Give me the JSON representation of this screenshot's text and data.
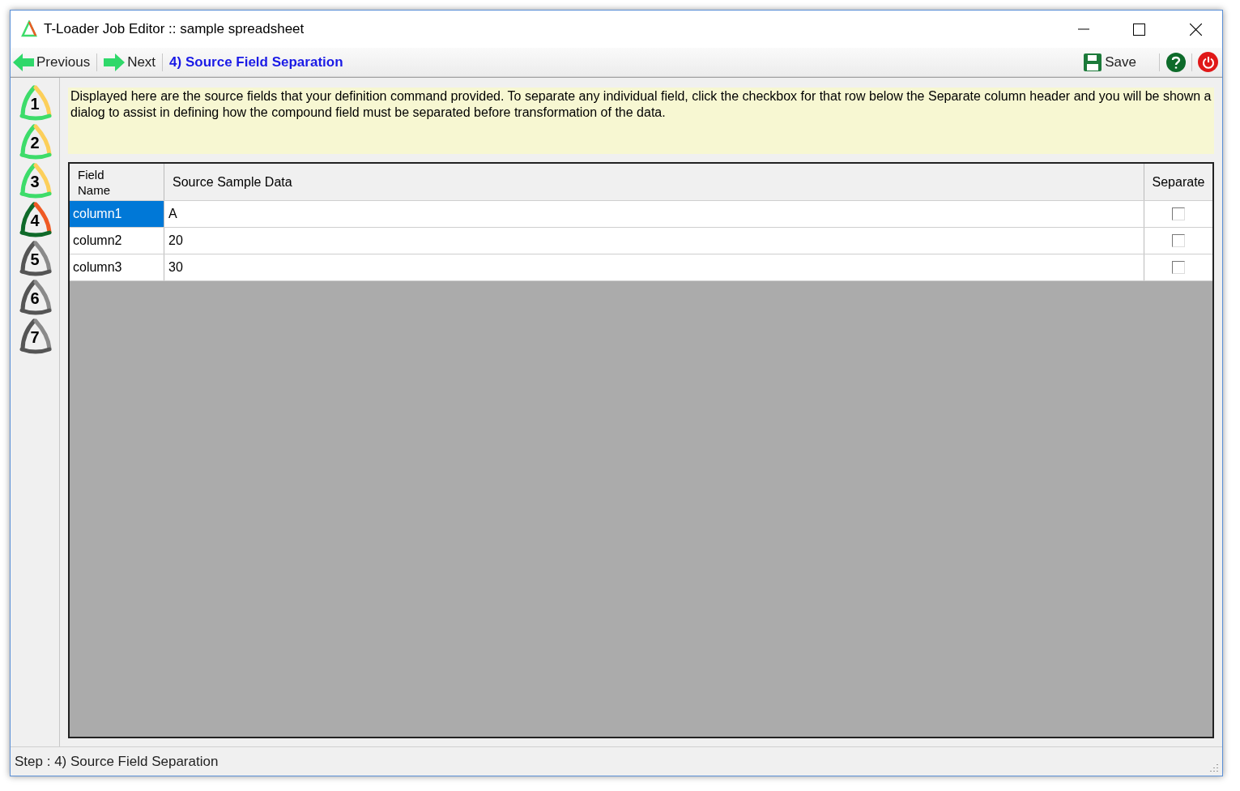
{
  "window": {
    "title": "T-Loader Job Editor :: sample spreadsheet"
  },
  "toolbar": {
    "previous": "Previous",
    "next": "Next",
    "step_title": "4) Source Field Separation",
    "save": "Save"
  },
  "steps": [
    {
      "number": "1",
      "kind": "done"
    },
    {
      "number": "2",
      "kind": "done"
    },
    {
      "number": "3",
      "kind": "done"
    },
    {
      "number": "4",
      "kind": "current"
    },
    {
      "number": "5",
      "kind": "pending"
    },
    {
      "number": "6",
      "kind": "pending"
    },
    {
      "number": "7",
      "kind": "pending"
    }
  ],
  "info": "Displayed here are the source fields that your definition command provided. To separate any individual field, click the checkbox for that row below the Separate column header and you will be shown a dialog to assist in defining how the compound field must be separated before transformation of the data.",
  "table": {
    "columns": [
      "Field Name",
      "Source Sample Data",
      "Separate"
    ],
    "rows": [
      {
        "field": "column1",
        "sample": "A",
        "separate": false,
        "selected": true
      },
      {
        "field": "column2",
        "sample": "20",
        "separate": false,
        "selected": false
      },
      {
        "field": "column3",
        "sample": "30",
        "separate": false,
        "selected": false
      }
    ]
  },
  "status_bar": "Step : 4) Source Field Separation"
}
